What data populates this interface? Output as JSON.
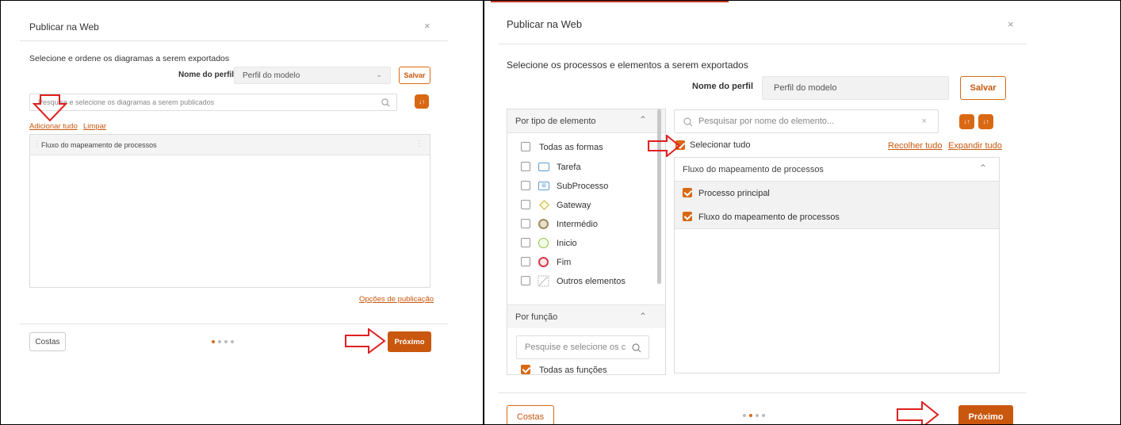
{
  "left": {
    "title": "Publicar na Web",
    "close": "×",
    "instruction": "Selecione e ordene os diagramas a serem exportados",
    "profile_label": "Nome do perfil",
    "profile_value": "Perfil do modelo",
    "save": "Salvar",
    "search_placeholder": "Pesquise e selecione os diagramas a serem publicados",
    "add_all": "Adicionar tudo",
    "clear": "Limpar",
    "list_item": "Fluxo do mapeamento de processos",
    "publish_options": "Opções de publicação",
    "back": "Costas",
    "next": "Próximo",
    "steps_total": 4,
    "step_active": 1
  },
  "right": {
    "title": "Publicar na Web",
    "close": "×",
    "instruction": "Selecione os processos e elementos a serem exportados",
    "profile_label": "Nome do perfil",
    "profile_value": "Perfil do modelo",
    "save": "Salvar",
    "filter_by_type": "Por tipo de elemento",
    "element_types": [
      {
        "label": "Todas as formas",
        "icon": "none"
      },
      {
        "label": "Tarefa",
        "icon": "task-icon"
      },
      {
        "label": "SubProcesso",
        "icon": "subprocess-icon"
      },
      {
        "label": "Gateway",
        "icon": "gateway-icon"
      },
      {
        "label": "Intermédio",
        "icon": "intermediate-event-icon"
      },
      {
        "label": "Inicio",
        "icon": "start-event-icon"
      },
      {
        "label": "Fim",
        "icon": "end-event-icon"
      },
      {
        "label": "Outros elementos",
        "icon": "other-elements-icon"
      }
    ],
    "filter_by_function": "Por função",
    "function_search_placeholder": "Pesquise e selecione os c",
    "all_functions": "Todas as funções",
    "element_search_placeholder": "Pesquisar por nome do elemento...",
    "select_all": "Selecionar tudo",
    "collapse_all": "Recolher tudo",
    "expand_all": "Expandir tudo",
    "tree_header": "Fluxo do mapeamento de processos",
    "tree_items": [
      "Processo principal",
      "Fluxo do mapeamento de processos"
    ],
    "back": "Costas",
    "next": "Próximo",
    "steps_total": 4,
    "step_active": 2
  },
  "colors": {
    "accent": "#d96813",
    "link": "#c9570d",
    "arrow": "#e02020"
  }
}
